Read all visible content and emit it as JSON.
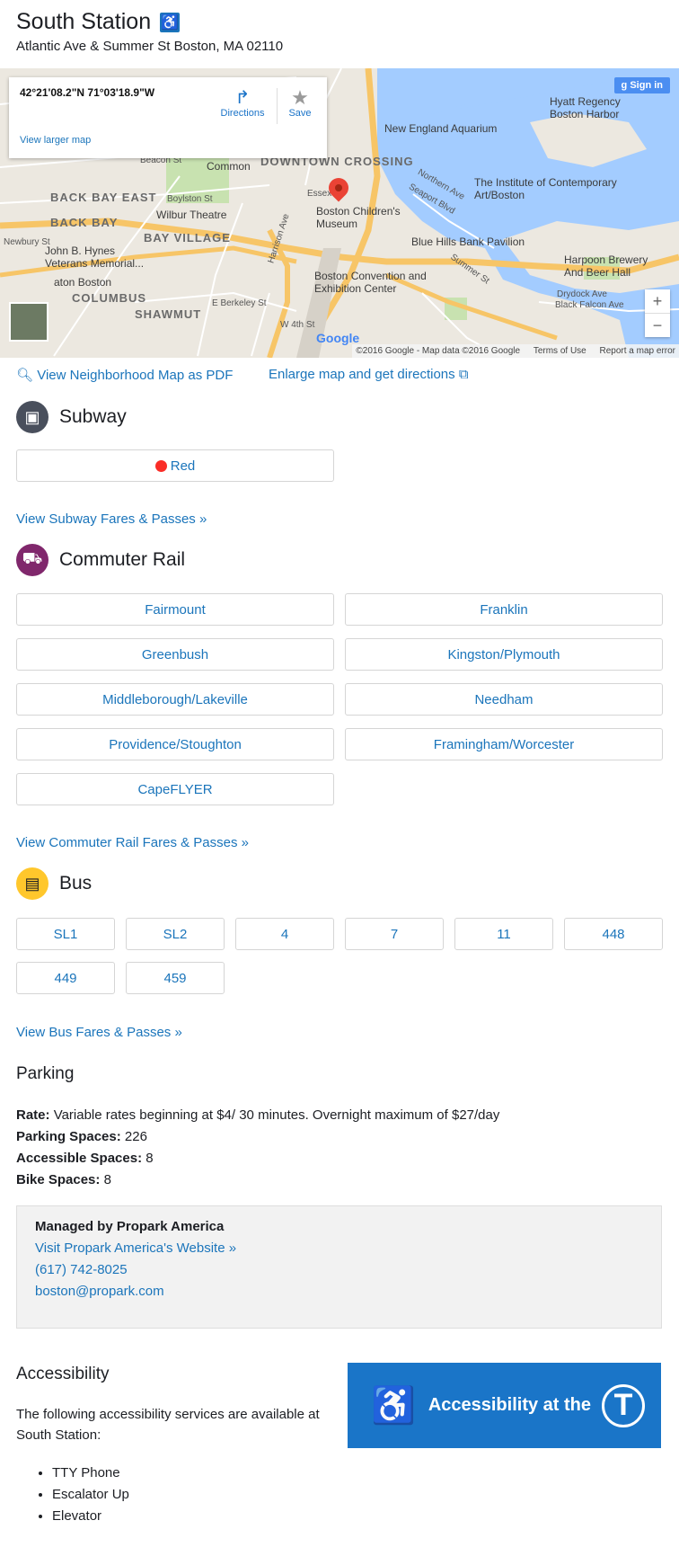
{
  "station": {
    "name": "South Station",
    "address": "Atlantic Ave & Summer St Boston, MA 02110",
    "accessible_icon": "wheelchair-icon"
  },
  "map": {
    "coords": "42°21'08.2\"N 71°03'18.9\"W",
    "view_larger": "View larger map",
    "directions": "Directions",
    "save": "Save",
    "sign_in": "Sign in",
    "zoom_in": "+",
    "zoom_out": "−",
    "google": "Google",
    "attribution": "©2016 Google - Map data ©2016 Google",
    "terms": "Terms of Use",
    "report": "Report a map error",
    "labels": {
      "downtown": "DOWNTOWN CROSSING",
      "backbay_east": "BACK BAY EAST",
      "backbay": "BACK BAY",
      "bayvillage": "BAY VILLAGE",
      "columbus": "COLUMBUS",
      "shawmut": "SHAWMUT",
      "aquarium": "New England Aquarium",
      "hyatt": "Hyatt Regency Boston Harbor",
      "ica": "The Institute of Contemporary Art/Boston",
      "common": "Boston Common",
      "wilbur": "Wilbur Theatre",
      "childrens": "Boston Children's Museum",
      "bluehills": "Blue Hills Bank Pavilion",
      "harpoon": "Harpoon Brewery And Beer Hall",
      "convention": "Boston Convention and Exhibition Center",
      "hynes": "John B. Hynes Veterans Memorial...",
      "aton": "aton Boston",
      "drydock": "Drydock Ave",
      "blackfalcon": "Black Falcon Ave",
      "beacon": "Beacon St",
      "boylston": "Boylston St",
      "essex": "Essex St",
      "harrison": "Harrison Ave",
      "berkeley": "E Berkeley St",
      "newbury": "Newbury St",
      "northern": "Northern Ave",
      "seaport": "Seaport Blvd",
      "summer": "Summer St",
      "w4th": "W 4th St"
    }
  },
  "links": {
    "neighborhood_pdf": "View Neighborhood Map as PDF",
    "enlarge": "Enlarge map and get directions"
  },
  "subway": {
    "title": "Subway",
    "routes": [
      "Red"
    ],
    "fares": "View Subway Fares & Passes »"
  },
  "commuter_rail": {
    "title": "Commuter Rail",
    "routes": [
      "Fairmount",
      "Franklin",
      "Greenbush",
      "Kingston/Plymouth",
      "Middleborough/Lakeville",
      "Needham",
      "Providence/Stoughton",
      "Framingham/Worcester",
      "CapeFLYER"
    ],
    "fares": "View Commuter Rail Fares & Passes »"
  },
  "bus": {
    "title": "Bus",
    "routes": [
      "SL1",
      "SL2",
      "4",
      "7",
      "11",
      "448",
      "449",
      "459"
    ],
    "fares": "View Bus Fares & Passes »"
  },
  "parking": {
    "title": "Parking",
    "rate_label": "Rate:",
    "rate": "Variable rates beginning at $4/ 30 minutes. Overnight maximum of $27/day",
    "spaces_label": "Parking Spaces:",
    "spaces": "226",
    "accessible_label": "Accessible Spaces:",
    "accessible": "8",
    "bike_label": "Bike Spaces:",
    "bike": "8",
    "manager": "Managed by Propark America",
    "website": "Visit Propark America's Website »",
    "phone": "(617) 742-8025",
    "email": "boston@propark.com"
  },
  "accessibility": {
    "title": "Accessibility",
    "intro": "The following accessibility services are available at South Station:",
    "banner": "Accessibility at the",
    "banner_logo": "T",
    "services": [
      "TTY Phone",
      "Escalator Up",
      "Elevator"
    ]
  },
  "colors": {
    "link": "#1b75bb",
    "red_line": "#fa2d27",
    "commuter_rail": "#80276c",
    "bus": "#ffc72c",
    "subway": "#494f5c",
    "banner": "#1a75c8"
  }
}
